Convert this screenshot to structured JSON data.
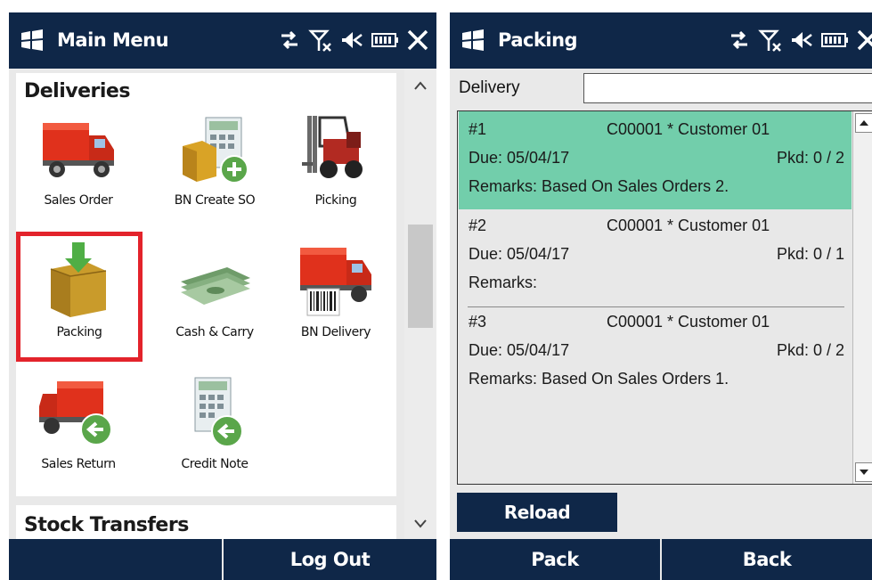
{
  "left": {
    "title": "Main Menu",
    "section_deliveries": "Deliveries",
    "tiles": [
      {
        "label": "Sales Order",
        "icon": "truck-icon"
      },
      {
        "label": "BN Create SO",
        "icon": "calculator-add-icon"
      },
      {
        "label": "Picking",
        "icon": "forklift-icon"
      },
      {
        "label": "Packing",
        "icon": "box-down-arrow-icon"
      },
      {
        "label": "Cash & Carry",
        "icon": "cash-icon"
      },
      {
        "label": "BN Delivery",
        "icon": "truck-barcode-icon"
      },
      {
        "label": "Sales Return",
        "icon": "truck-return-icon"
      },
      {
        "label": "Credit Note",
        "icon": "calculator-return-icon"
      }
    ],
    "section_stock": "Stock Transfers",
    "softkey_left": "",
    "softkey_right": "Log Out"
  },
  "right": {
    "title": "Packing",
    "delivery_label": "Delivery",
    "delivery_value": "",
    "items": [
      {
        "num": "#1",
        "customer": "C00001 * Customer 01",
        "due": "Due: 05/04/17",
        "pkd": "Pkd: 0 / 2",
        "remarks": "Remarks: Based On Sales Orders 2."
      },
      {
        "num": "#2",
        "customer": "C00001 * Customer 01",
        "due": "Due: 05/04/17",
        "pkd": "Pkd: 0 / 1",
        "remarks": "Remarks:"
      },
      {
        "num": "#3",
        "customer": "C00001 * Customer 01",
        "due": "Due: 05/04/17",
        "pkd": "Pkd: 0 / 2",
        "remarks": "Remarks: Based On Sales Orders 1."
      }
    ],
    "reload_label": "Reload",
    "softkey_left": "Pack",
    "softkey_right": "Back"
  },
  "colors": {
    "titlebar": "#0f2748",
    "selected_row": "#72ceab",
    "highlight_border": "#e3232b"
  }
}
